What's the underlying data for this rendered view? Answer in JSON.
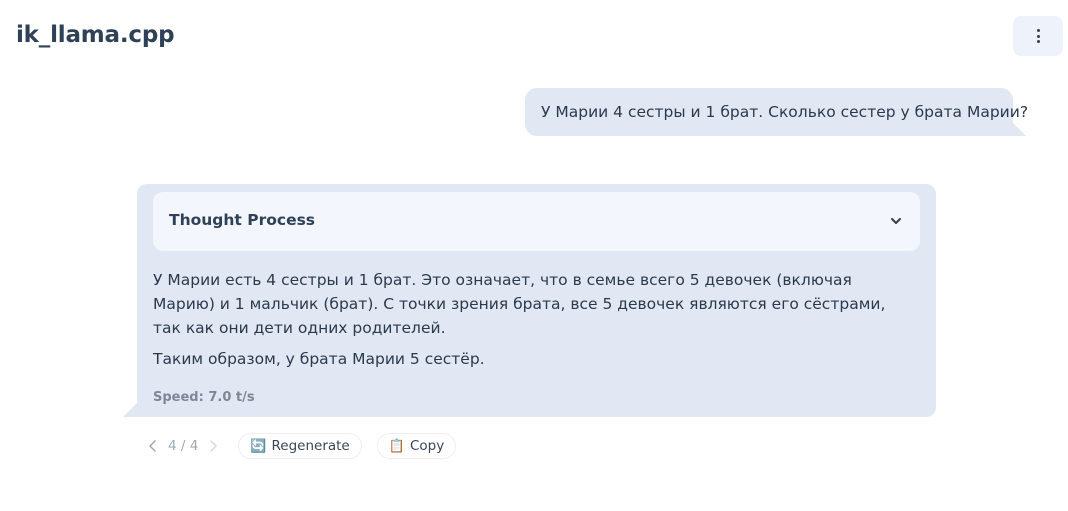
{
  "header": {
    "title": "ik_llama.cpp",
    "menu_icon": "more-vertical-icon"
  },
  "conversation": {
    "user_message": "У Марии 4 сестры и 1 брат. Сколько сестер у брата Марии?",
    "assistant": {
      "thought_title": "Thought Process",
      "thought_toggle_icon": "chevron-down-icon",
      "paragraphs": [
        "У Марии есть 4 сестры и 1 брат. Это означает, что в семье всего 5 девочек (включая Марию) и 1 мальчик (брат). С точки зрения брата, все 5 девочек являются его сёстрами, так как они дети одних родителей.",
        "Таким образом, у брата Марии 5 сестёр."
      ],
      "speed": "Speed: 7.0 t/s"
    }
  },
  "actions": {
    "pager": "4 / 4",
    "prev_icon": "chevron-left-icon",
    "next_icon": "chevron-right-icon",
    "regenerate_icon": "🔄",
    "regenerate_label": "Regenerate",
    "copy_icon": "📋",
    "copy_label": "Copy"
  },
  "colors": {
    "bubble": "#e2e8f3",
    "panel": "#f3f6fc",
    "title": "#2f4157"
  }
}
